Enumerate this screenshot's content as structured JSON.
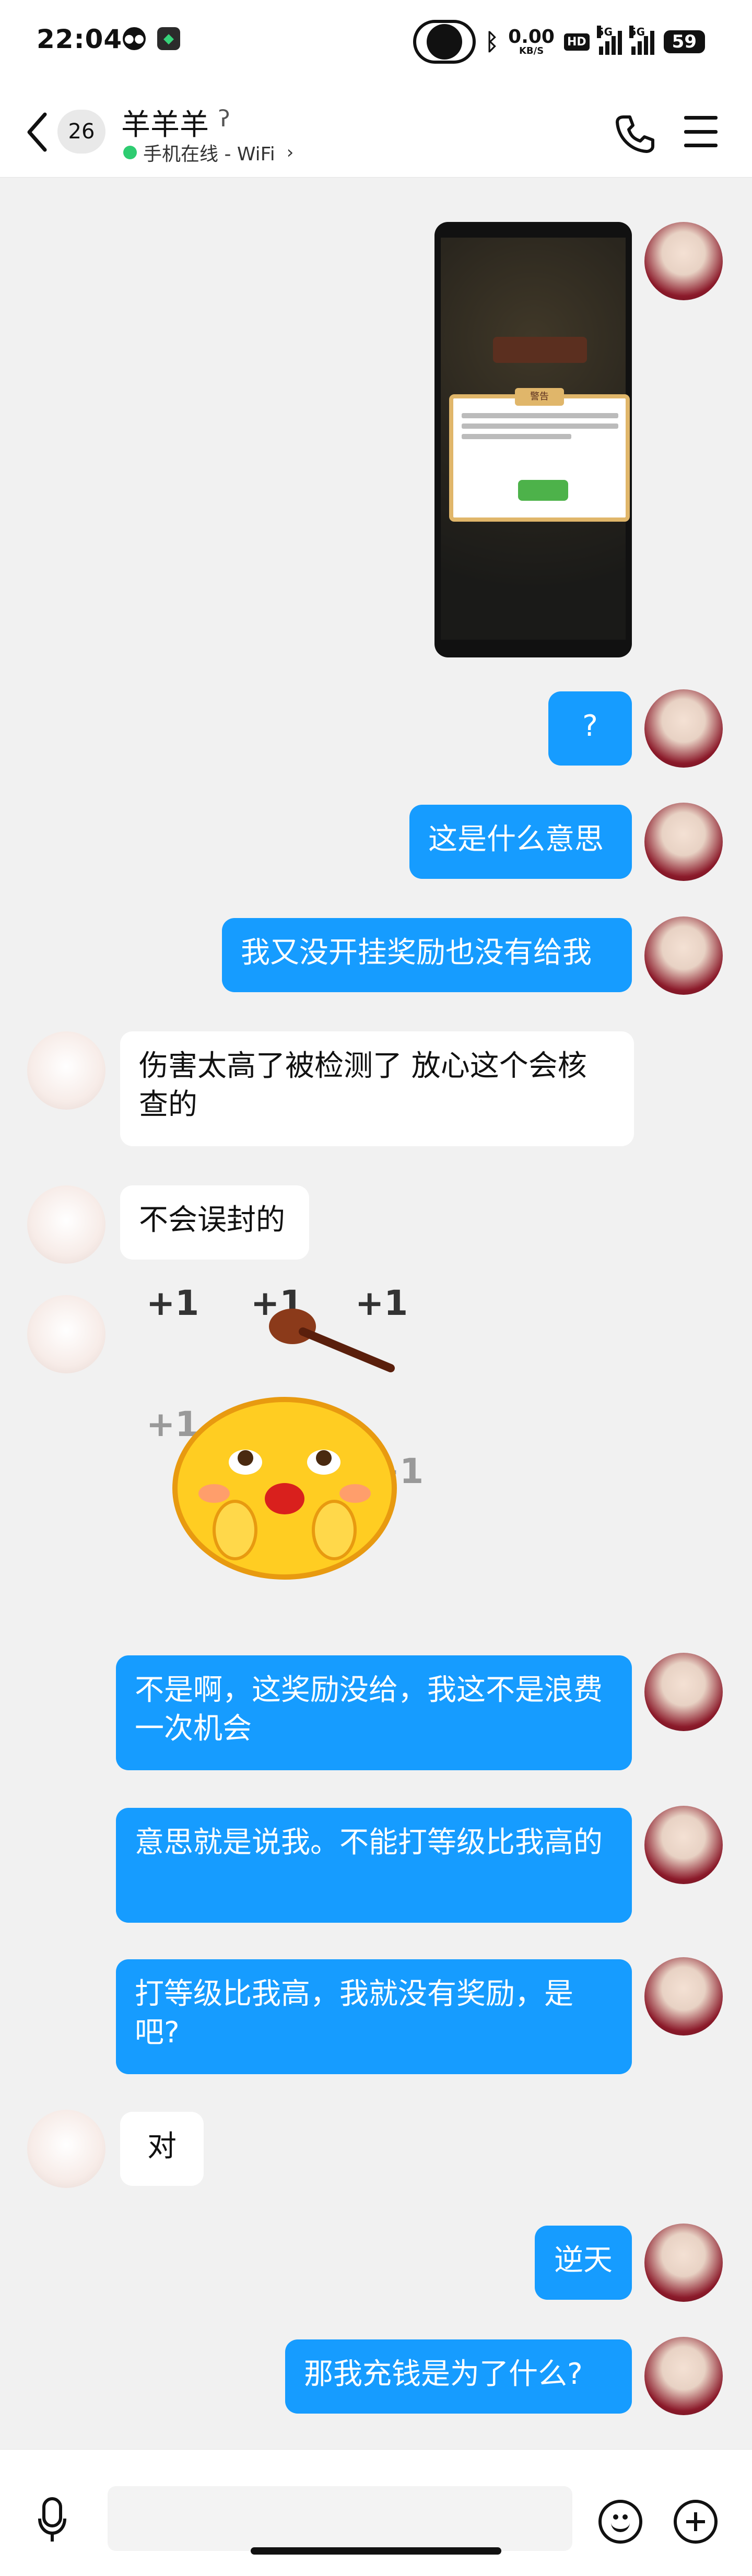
{
  "status_bar": {
    "time": "22:04",
    "net_speed_value": "0.00",
    "net_speed_unit": "KB/S",
    "hd_badge": "HD",
    "signal_1_label": "5G",
    "signal_2_label": "5G",
    "battery": "59",
    "icons": [
      "wechat-icon",
      "app-icon",
      "camera-cutout",
      "bluetooth-icon",
      "signal-icon",
      "battery-icon"
    ]
  },
  "header": {
    "unread_count": "26",
    "contact_name": "羊羊羊",
    "presence": "手机在线 - WiFi",
    "presence_color": "#2ecc71",
    "icons": [
      "back-icon",
      "ear-icon",
      "phone-icon",
      "menu-icon"
    ]
  },
  "messages": [
    {
      "from": "me",
      "type": "image"
    },
    {
      "from": "me",
      "type": "text",
      "text": "?"
    },
    {
      "from": "me",
      "type": "text",
      "text": "这是什么意思"
    },
    {
      "from": "me",
      "type": "text",
      "text": "我又没开挂奖励也没有给我"
    },
    {
      "from": "peer",
      "type": "text",
      "text": "伤害太高了被检测了 放心这个会核查的"
    },
    {
      "from": "peer",
      "type": "text",
      "text": "不会误封的"
    },
    {
      "from": "peer",
      "type": "sticker",
      "sticker_text": "+1"
    },
    {
      "from": "me",
      "type": "text",
      "text": "不是啊，这奖励没给，我这不是浪费一次机会"
    },
    {
      "from": "me",
      "type": "text",
      "text": "意思就是说我。不能打等级比我高的"
    },
    {
      "from": "me",
      "type": "text",
      "text": "打等级比我高，我就没有奖励，是吧?"
    },
    {
      "from": "peer",
      "type": "text",
      "text": "对"
    },
    {
      "from": "me",
      "type": "text",
      "text": "逆天"
    },
    {
      "from": "me",
      "type": "text",
      "text": "那我充钱是为了什么?"
    }
  ],
  "image_message": {
    "dialog_head": "警告"
  },
  "input_bar": {
    "placeholder": "",
    "icons": [
      "mic-icon",
      "emoji-icon",
      "plus-icon"
    ]
  },
  "colors": {
    "my_bubble": "#169cff",
    "peer_bubble": "#ffffff",
    "background": "#f1f1f1"
  }
}
